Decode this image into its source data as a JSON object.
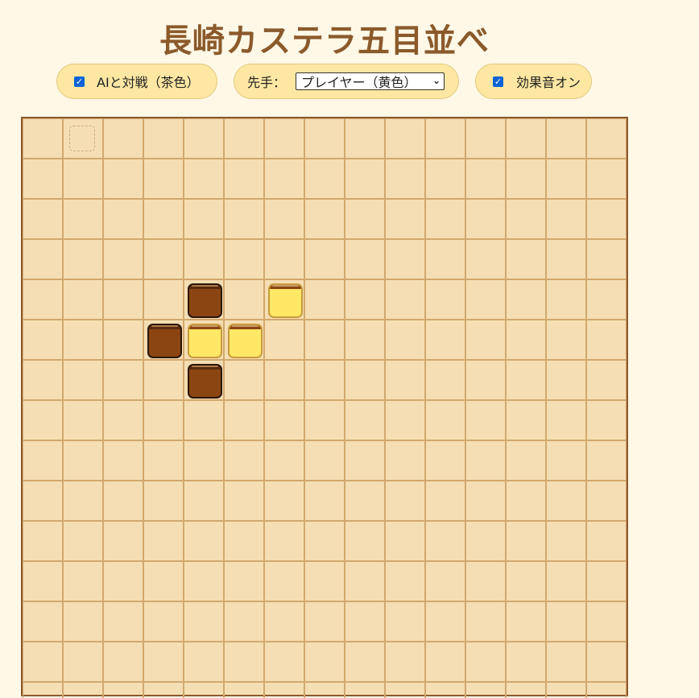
{
  "title": "長崎カステラ五目並べ",
  "controls": {
    "ai_label": "AIと対戦（茶色）",
    "ai_checked": true,
    "first_label": "先手：",
    "first_selected": "プレイヤー（黄色）",
    "sound_label": "効果音オン",
    "sound_checked": true
  },
  "colors": {
    "background": "#fff8e7",
    "title": "#8b5a2b",
    "pill": "#fde7a3",
    "board": "#f5deb3",
    "grid_line": "#d2a86e",
    "brown_piece": "#8b4513",
    "yellow_piece": "#ffe866"
  },
  "board": {
    "columns": 15,
    "visible_rows": 14,
    "hover_cell": {
      "row": 0,
      "col": 1
    },
    "pieces": [
      {
        "row": 4,
        "col": 4,
        "color": "brown"
      },
      {
        "row": 4,
        "col": 6,
        "color": "yellow"
      },
      {
        "row": 5,
        "col": 3,
        "color": "brown"
      },
      {
        "row": 5,
        "col": 4,
        "color": "yellow"
      },
      {
        "row": 5,
        "col": 5,
        "color": "yellow"
      },
      {
        "row": 6,
        "col": 4,
        "color": "brown"
      }
    ]
  }
}
